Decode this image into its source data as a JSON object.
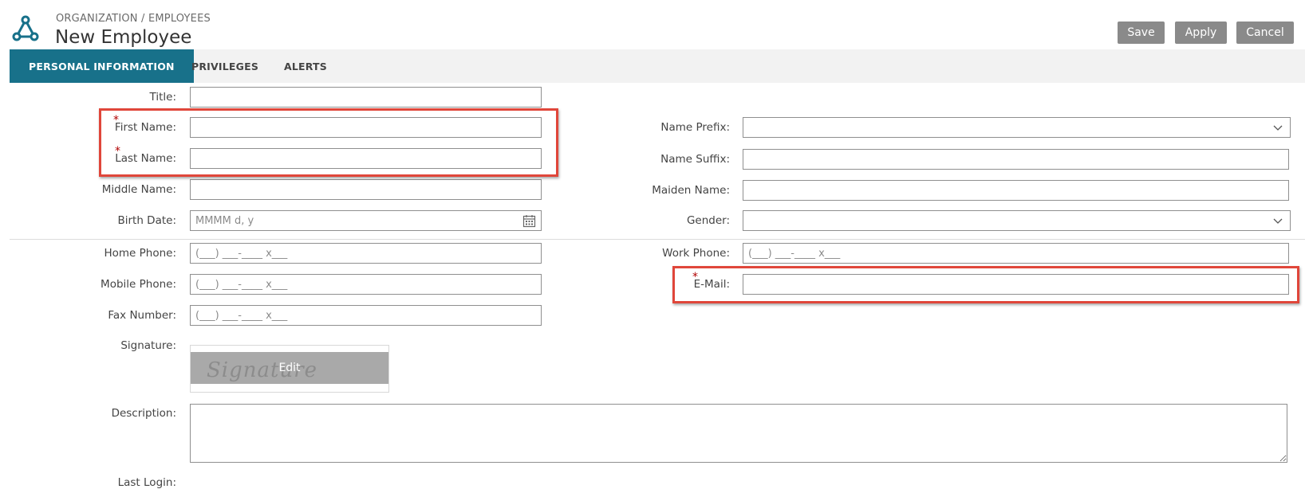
{
  "header": {
    "breadcrumb": "ORGANIZATION / EMPLOYEES",
    "title": "New Employee",
    "logo_icon": "tri-node-logo-icon",
    "buttons": {
      "save": "Save",
      "apply": "Apply",
      "cancel": "Cancel"
    }
  },
  "tabs": [
    {
      "label": "PERSONAL INFORMATION",
      "active": true
    },
    {
      "label": "PRIVILEGES",
      "active": false
    },
    {
      "label": "ALERTS",
      "active": false
    }
  ],
  "form": {
    "left": {
      "title": {
        "label": "Title:",
        "value": ""
      },
      "first_name": {
        "label": "First Name:",
        "required": true,
        "value": ""
      },
      "last_name": {
        "label": "Last Name:",
        "required": true,
        "value": ""
      },
      "middle_name": {
        "label": "Middle Name:",
        "value": ""
      },
      "birth_date": {
        "label": "Birth Date:",
        "placeholder": "MMMM d, y",
        "icon": "calendar-icon"
      },
      "home_phone": {
        "label": "Home Phone:",
        "placeholder": "(___) ___-____ x___"
      },
      "mobile_phone": {
        "label": "Mobile Phone:",
        "placeholder": "(___) ___-____ x___"
      },
      "fax_number": {
        "label": "Fax Number:",
        "placeholder": "(___) ___-____ x___"
      },
      "signature": {
        "label": "Signature:",
        "watermark": "Signature Here...",
        "edit": "Edit"
      },
      "description": {
        "label": "Description:",
        "value": ""
      },
      "last_login": {
        "label": "Last Login:"
      }
    },
    "right": {
      "name_prefix": {
        "label": "Name Prefix:",
        "value": "",
        "icon": "chevron-down-icon"
      },
      "name_suffix": {
        "label": "Name Suffix:",
        "value": ""
      },
      "maiden_name": {
        "label": "Maiden Name:",
        "value": ""
      },
      "gender": {
        "label": "Gender:",
        "value": "",
        "icon": "chevron-down-icon"
      },
      "work_phone": {
        "label": "Work Phone:",
        "placeholder": "(___) ___-____ x___"
      },
      "email": {
        "label": "E-Mail:",
        "required": true,
        "value": ""
      }
    }
  },
  "colors": {
    "accent": "#18718a",
    "button_gray": "#8a8a8a",
    "highlight": "#e0463a",
    "required_star": "#b00000"
  }
}
